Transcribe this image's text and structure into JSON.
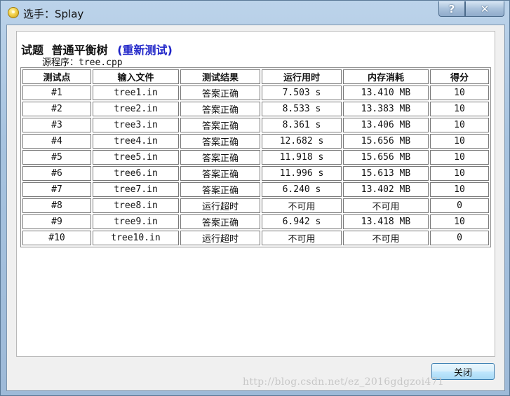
{
  "window": {
    "title": "选手：Splay",
    "help_glyph": "?",
    "close_glyph": "✕"
  },
  "header": {
    "problem_label": "试题",
    "problem_name": "普通平衡树",
    "retest_link": "(重新测试)",
    "source_label": "源程序：",
    "source_file": "tree.cpp"
  },
  "table": {
    "columns": [
      "测试点",
      "输入文件",
      "测试结果",
      "运行用时",
      "内存消耗",
      "得分"
    ],
    "rows": [
      [
        "#1",
        "tree1.in",
        "答案正确",
        "7.503 s",
        "13.410 MB",
        "10"
      ],
      [
        "#2",
        "tree2.in",
        "答案正确",
        "8.533 s",
        "13.383 MB",
        "10"
      ],
      [
        "#3",
        "tree3.in",
        "答案正确",
        "8.361 s",
        "13.406 MB",
        "10"
      ],
      [
        "#4",
        "tree4.in",
        "答案正确",
        "12.682 s",
        "15.656 MB",
        "10"
      ],
      [
        "#5",
        "tree5.in",
        "答案正确",
        "11.918 s",
        "15.656 MB",
        "10"
      ],
      [
        "#6",
        "tree6.in",
        "答案正确",
        "11.996 s",
        "15.613 MB",
        "10"
      ],
      [
        "#7",
        "tree7.in",
        "答案正确",
        "6.240 s",
        "13.402 MB",
        "10"
      ],
      [
        "#8",
        "tree8.in",
        "运行超时",
        "不可用",
        "不可用",
        "0"
      ],
      [
        "#9",
        "tree9.in",
        "答案正确",
        "6.942 s",
        "13.418 MB",
        "10"
      ],
      [
        "#10",
        "tree10.in",
        "运行超时",
        "不可用",
        "不可用",
        "0"
      ]
    ]
  },
  "footer": {
    "close_button": "关闭",
    "watermark": "http://blog.csdn.net/ez_2016gdgzoi471"
  },
  "colors": {
    "retest_link": "#1f24c8",
    "button_border": "#3c7fb1"
  },
  "icons": {
    "app": "app-coin-icon",
    "help": "help-icon",
    "close": "close-icon"
  }
}
